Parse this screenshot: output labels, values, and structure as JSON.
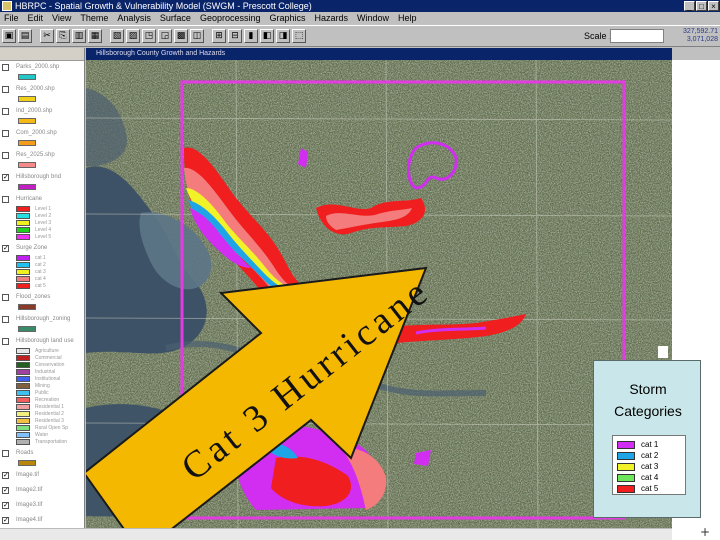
{
  "window": {
    "title": "HBRPC - Spatial Growth & Vulnerability Model (SWGM - Prescott College)",
    "buttons": [
      "_",
      "□",
      "×"
    ]
  },
  "menu": [
    "File",
    "Edit",
    "View",
    "Theme",
    "Analysis",
    "Surface",
    "Geoprocessing",
    "Graphics",
    "Hazards",
    "Window",
    "Help"
  ],
  "toolbar": {
    "buttons": [
      "▣",
      "▤",
      "✂",
      "⎘",
      "▥",
      "▦",
      "▧",
      "▨",
      "◳",
      "◲",
      "▩",
      "◫",
      "⊞",
      "⊟",
      "▮",
      "◧",
      "◨",
      "⬚"
    ],
    "scale_label": "Scale 1:",
    "scale_value": "",
    "coords": [
      "327,592.71",
      "3,071,028"
    ]
  },
  "map": {
    "title": "Hillsborough County Growth and Hazards",
    "arrow_text": "Cat 3 Hurricane",
    "arrow_color": "#f5b800"
  },
  "toc": {
    "header": "",
    "layers": [
      {
        "name": "Parks_2000.shp",
        "color": "#22c7c7",
        "checked": false
      },
      {
        "name": "Res_2000.shp",
        "color": "#f2d11a",
        "checked": false
      },
      {
        "name": "Ind_2000.shp",
        "color": "#f5b814",
        "checked": false
      },
      {
        "name": "Com_2000.shp",
        "color": "#f59c1a",
        "checked": false
      },
      {
        "name": "Res_2025.shp",
        "color": "#f58a8a",
        "checked": false
      },
      {
        "name": "Hillsborough bnd",
        "color": "#c41fc4",
        "checked": true
      },
      {
        "name": "Hurricane",
        "color": "",
        "checked": false
      },
      {
        "name": "Surge Zone",
        "color": "",
        "checked": true
      },
      {
        "name": "Flood_zones",
        "color": "#8b3a2a",
        "checked": false
      },
      {
        "name": "Hillsborough_zoning",
        "color": "#3a8b6a",
        "checked": false
      },
      {
        "name": "Hillsborough land use",
        "color": "",
        "checked": false
      },
      {
        "name": "Roads",
        "color": "#b8860b",
        "checked": false
      },
      {
        "name": "Image.tif",
        "color": "",
        "checked": true
      },
      {
        "name": "Image2.tif",
        "color": "",
        "checked": true
      },
      {
        "name": "Image3.tif",
        "color": "",
        "checked": true
      },
      {
        "name": "Image4.tif",
        "color": "",
        "checked": true
      }
    ],
    "hurricane_legend": [
      {
        "label": "Level 1",
        "color": "#f02020"
      },
      {
        "label": "Level 2",
        "color": "#22e0e0"
      },
      {
        "label": "Level 3",
        "color": "#f0f020"
      },
      {
        "label": "Level 4",
        "color": "#20d020"
      },
      {
        "label": "Level 5",
        "color": "#f030f0"
      }
    ],
    "surge_legend": [
      {
        "label": "cat 1",
        "color": "#c020f0"
      },
      {
        "label": "cat 2",
        "color": "#20c0f0"
      },
      {
        "label": "cat 3",
        "color": "#f0f020"
      },
      {
        "label": "cat 4",
        "color": "#f08080"
      },
      {
        "label": "cat 5",
        "color": "#f02020"
      }
    ],
    "landuse_legend": [
      {
        "label": "Agriculture",
        "color": "#e6e6e6"
      },
      {
        "label": "Commercial",
        "color": "#c02020"
      },
      {
        "label": "Conservation",
        "color": "#206020"
      },
      {
        "label": "Industrial",
        "color": "#a040a0"
      },
      {
        "label": "Institutional",
        "color": "#4060f0"
      },
      {
        "label": "Mining",
        "color": "#806040"
      },
      {
        "label": "Public",
        "color": "#40c0f0"
      },
      {
        "label": "Recreation",
        "color": "#f06060"
      },
      {
        "label": "Residential 1",
        "color": "#f0a0a0"
      },
      {
        "label": "Residential 2",
        "color": "#f0f080"
      },
      {
        "label": "Residential 3",
        "color": "#f0c040"
      },
      {
        "label": "Rural Open Sp",
        "color": "#80e080"
      },
      {
        "label": "Water",
        "color": "#80c0ff"
      },
      {
        "label": "Transportation",
        "color": "#b0b0b0"
      }
    ]
  },
  "storm": {
    "title_line1": "Storm",
    "title_line2": "Categories",
    "items": [
      {
        "label": "cat 1",
        "color": "#d12ef2"
      },
      {
        "label": "cat 2",
        "color": "#1ea5e8"
      },
      {
        "label": "cat 3",
        "color": "#f2f228"
      },
      {
        "label": "cat 4",
        "color": "#6ee65c"
      },
      {
        "label": "cat 5",
        "color": "#f01e1e"
      }
    ]
  }
}
